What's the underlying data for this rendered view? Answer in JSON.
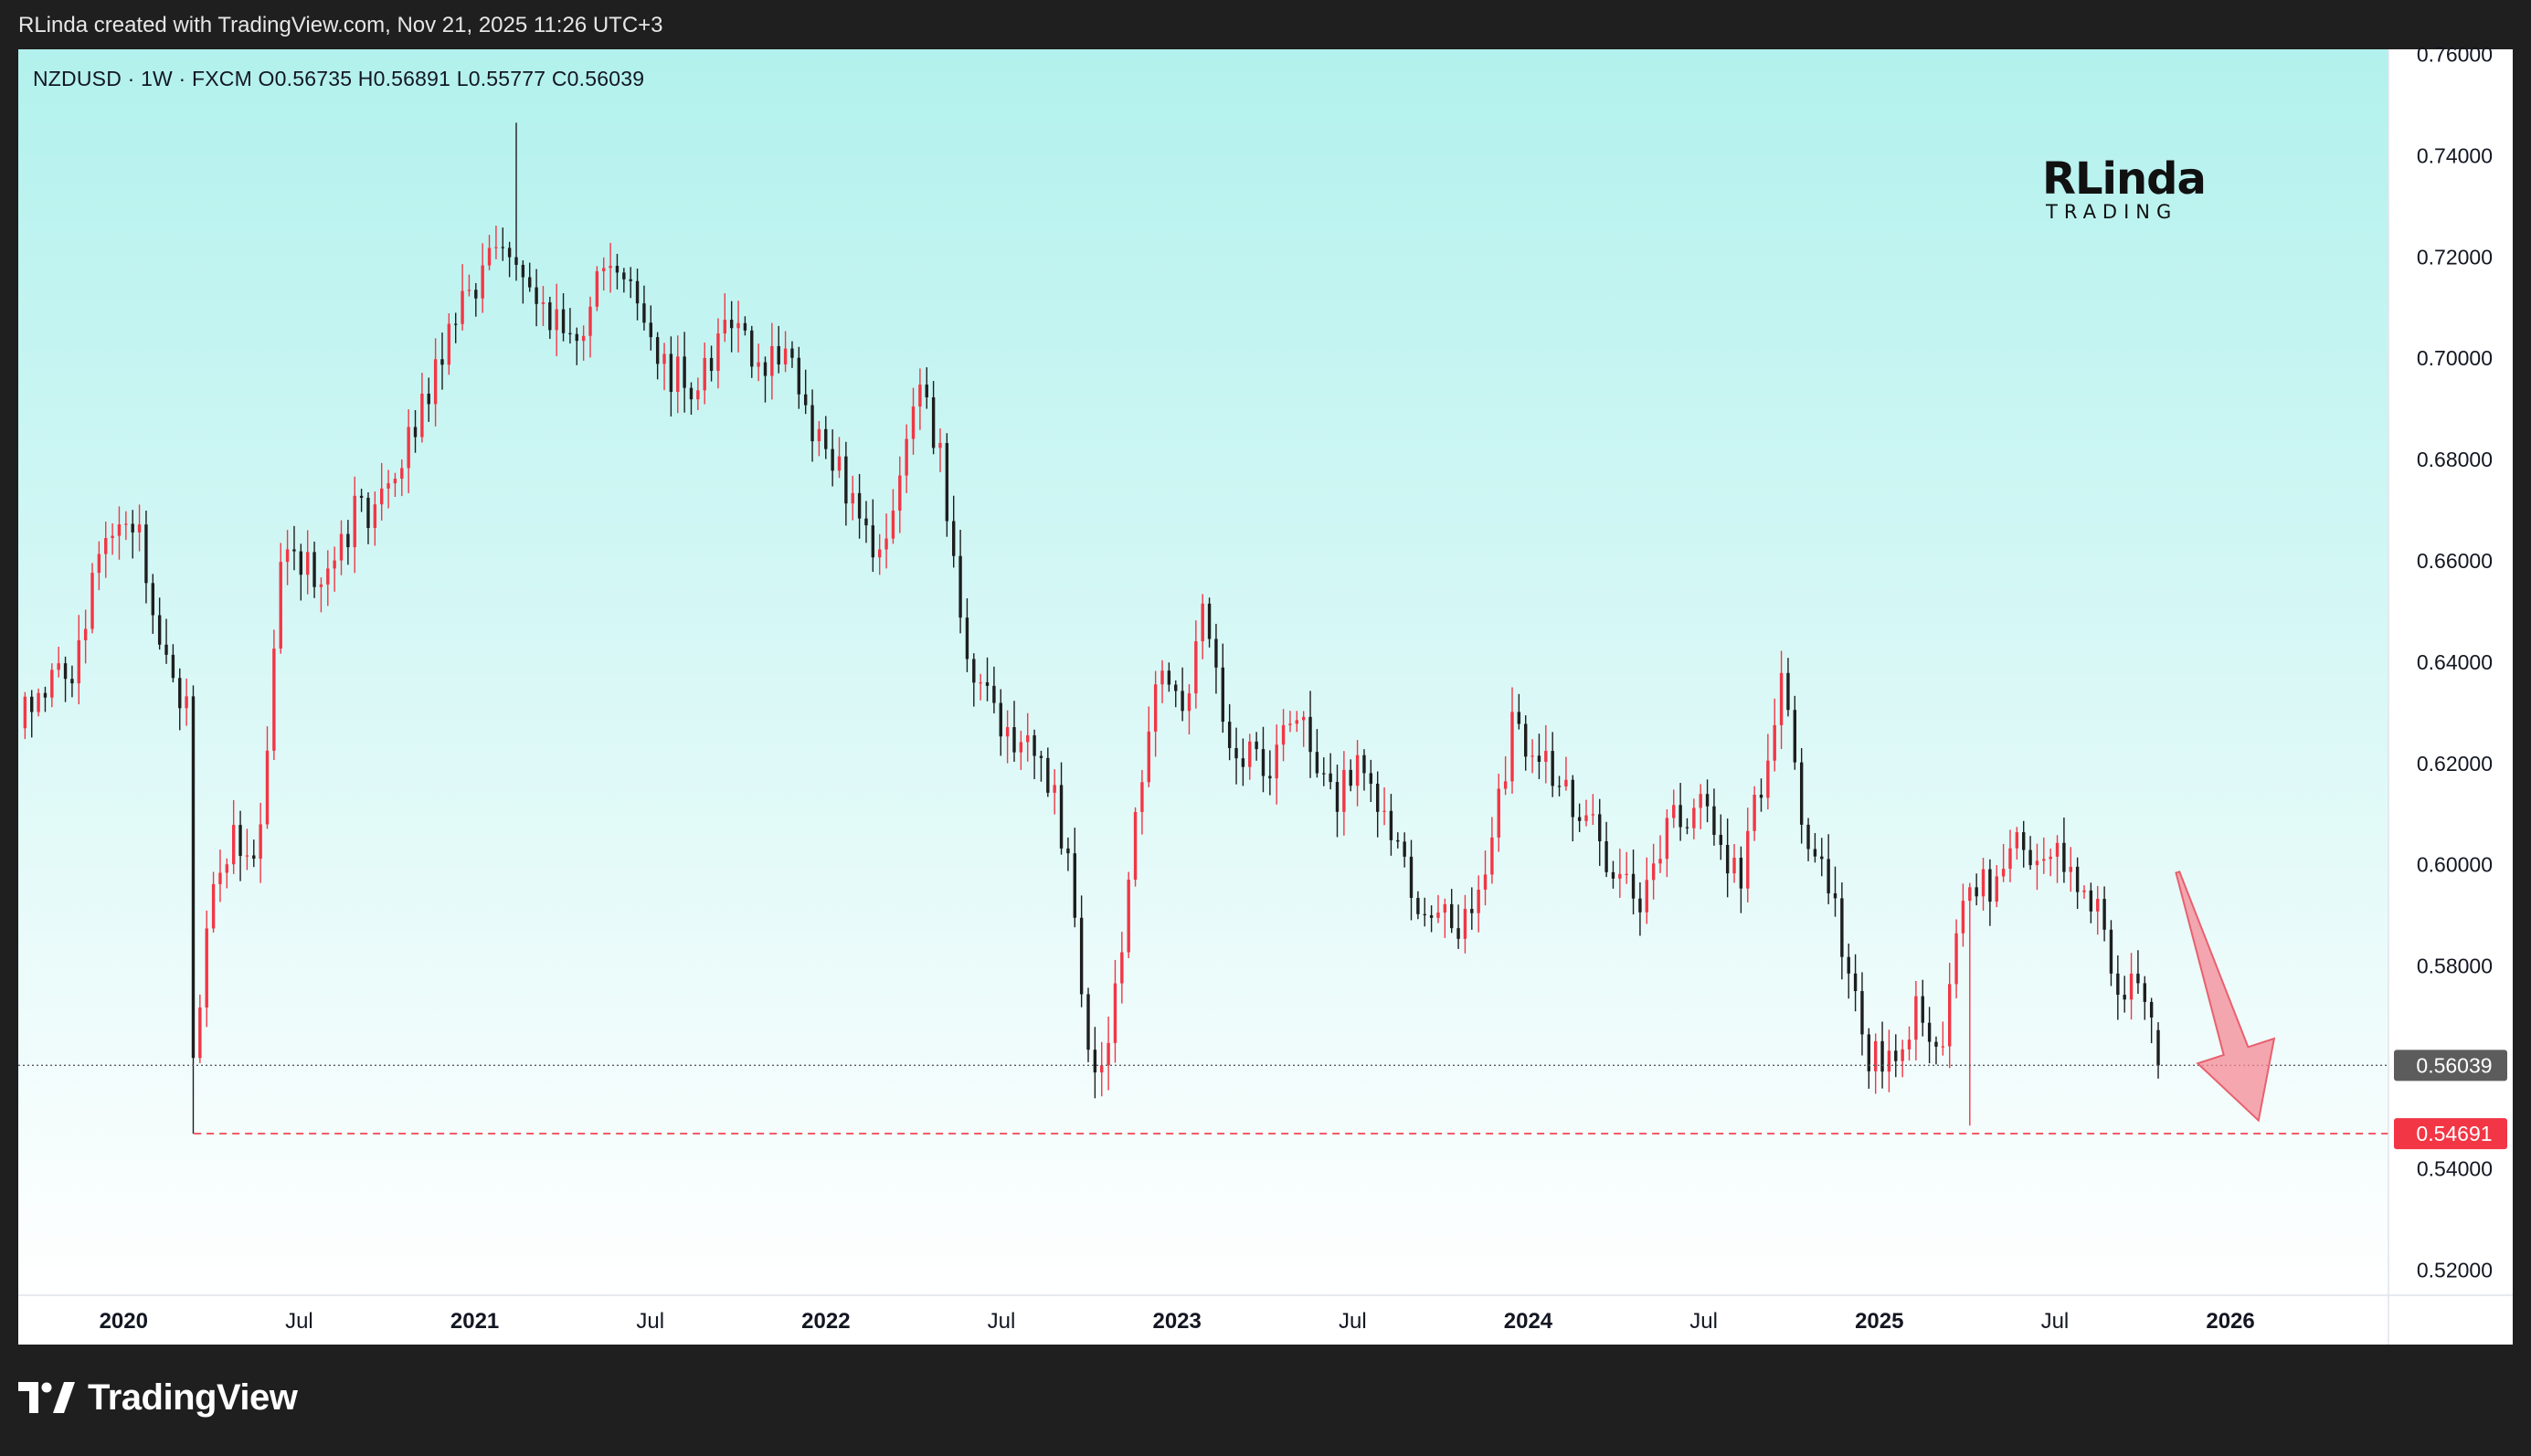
{
  "attribution": "RLinda created with TradingView.com, Nov 21, 2025 11:26 UTC+3",
  "symbol_line": "NZDUSD · 1W · FXCM   O0.56735   H0.56891   L0.55777   C0.56039",
  "logo": {
    "main": "RLinda",
    "sub": "TRADING"
  },
  "brand": {
    "name": "TradingView"
  },
  "colors": {
    "bg_top": "#b2f1ed",
    "bg_bottom": "#ffffff",
    "up": "#f23645",
    "down": "#1e1e1e",
    "current_label": "#5c5c5c",
    "support": "#f23645",
    "arrow": "#f58a95"
  },
  "chart_data": {
    "type": "candlestick",
    "symbol": "NZDUSD",
    "timeframe": "1W",
    "source": "FXCM",
    "ohlc_last": {
      "open": 0.56735,
      "high": 0.56891,
      "low": 0.55777,
      "close": 0.56039
    },
    "ylim": [
      0.515,
      0.761
    ],
    "yticks": [
      "0.76000",
      "0.74000",
      "0.72000",
      "0.70000",
      "0.68000",
      "0.66000",
      "0.64000",
      "0.62000",
      "0.60000",
      "0.58000",
      "0.56000",
      "0.54000",
      "0.52000"
    ],
    "xlim": [
      2019.7,
      2026.45
    ],
    "xticks": [
      {
        "label": "2020",
        "x": 2020.0,
        "bold": true
      },
      {
        "label": "Jul",
        "x": 2020.5,
        "bold": false
      },
      {
        "label": "2021",
        "x": 2021.0,
        "bold": true
      },
      {
        "label": "Jul",
        "x": 2021.5,
        "bold": false
      },
      {
        "label": "2022",
        "x": 2022.0,
        "bold": true
      },
      {
        "label": "Jul",
        "x": 2022.5,
        "bold": false
      },
      {
        "label": "2023",
        "x": 2023.0,
        "bold": true
      },
      {
        "label": "Jul",
        "x": 2023.5,
        "bold": false
      },
      {
        "label": "2024",
        "x": 2024.0,
        "bold": true
      },
      {
        "label": "Jul",
        "x": 2024.5,
        "bold": false
      },
      {
        "label": "2025",
        "x": 2025.0,
        "bold": true
      },
      {
        "label": "Jul",
        "x": 2025.5,
        "bold": false
      },
      {
        "label": "2026",
        "x": 2026.0,
        "bold": true
      }
    ],
    "current_price": {
      "value": 0.56039,
      "label": "0.56039"
    },
    "support_level": {
      "value": 0.54691,
      "label": "0.54691",
      "style": "dashed"
    },
    "arrow": {
      "from": {
        "x": 2025.85,
        "y": 0.5985
      },
      "to": {
        "x": 2026.08,
        "y": 0.5495
      },
      "direction": "down"
    },
    "anchors": [
      [
        2019.7,
        0.63
      ],
      [
        2019.85,
        0.638
      ],
      [
        2019.93,
        0.662
      ],
      [
        2020.0,
        0.67
      ],
      [
        2020.05,
        0.665
      ],
      [
        2020.12,
        0.64
      ],
      [
        2020.18,
        0.63
      ],
      [
        2020.2,
        0.56
      ],
      [
        2020.25,
        0.595
      ],
      [
        2020.3,
        0.605
      ],
      [
        2020.38,
        0.6
      ],
      [
        2020.45,
        0.66
      ],
      [
        2020.55,
        0.658
      ],
      [
        2020.65,
        0.668
      ],
      [
        2020.75,
        0.673
      ],
      [
        2020.85,
        0.69
      ],
      [
        2020.95,
        0.71
      ],
      [
        2021.05,
        0.718
      ],
      [
        2021.12,
        0.722
      ],
      [
        2021.2,
        0.712
      ],
      [
        2021.28,
        0.7
      ],
      [
        2021.35,
        0.718
      ],
      [
        2021.45,
        0.712
      ],
      [
        2021.55,
        0.698
      ],
      [
        2021.65,
        0.695
      ],
      [
        2021.72,
        0.712
      ],
      [
        2021.8,
        0.7
      ],
      [
        2021.9,
        0.7
      ],
      [
        2022.0,
        0.68
      ],
      [
        2022.1,
        0.672
      ],
      [
        2022.15,
        0.66
      ],
      [
        2022.22,
        0.678
      ],
      [
        2022.27,
        0.692
      ],
      [
        2022.33,
        0.68
      ],
      [
        2022.4,
        0.642
      ],
      [
        2022.48,
        0.63
      ],
      [
        2022.55,
        0.62
      ],
      [
        2022.6,
        0.625
      ],
      [
        2022.65,
        0.612
      ],
      [
        2022.7,
        0.595
      ],
      [
        2022.76,
        0.56
      ],
      [
        2022.82,
        0.57
      ],
      [
        2022.88,
        0.612
      ],
      [
        2022.95,
        0.636
      ],
      [
        2023.02,
        0.63
      ],
      [
        2023.08,
        0.65
      ],
      [
        2023.15,
        0.62
      ],
      [
        2023.25,
        0.62
      ],
      [
        2023.35,
        0.628
      ],
      [
        2023.45,
        0.61
      ],
      [
        2023.52,
        0.622
      ],
      [
        2023.6,
        0.61
      ],
      [
        2023.68,
        0.595
      ],
      [
        2023.78,
        0.588
      ],
      [
        2023.85,
        0.59
      ],
      [
        2023.9,
        0.61
      ],
      [
        2023.96,
        0.628
      ],
      [
        2024.05,
        0.62
      ],
      [
        2024.15,
        0.612
      ],
      [
        2024.25,
        0.598
      ],
      [
        2024.32,
        0.592
      ],
      [
        2024.4,
        0.608
      ],
      [
        2024.48,
        0.612
      ],
      [
        2024.55,
        0.605
      ],
      [
        2024.6,
        0.595
      ],
      [
        2024.65,
        0.612
      ],
      [
        2024.72,
        0.635
      ],
      [
        2024.78,
        0.61
      ],
      [
        2024.85,
        0.595
      ],
      [
        2024.9,
        0.585
      ],
      [
        2024.98,
        0.56
      ],
      [
        2025.05,
        0.565
      ],
      [
        2025.12,
        0.572
      ],
      [
        2025.18,
        0.565
      ],
      [
        2025.25,
        0.598
      ],
      [
        2025.32,
        0.596
      ],
      [
        2025.4,
        0.603
      ],
      [
        2025.48,
        0.602
      ],
      [
        2025.55,
        0.598
      ],
      [
        2025.62,
        0.59
      ],
      [
        2025.68,
        0.578
      ],
      [
        2025.73,
        0.575
      ],
      [
        2025.79,
        0.569
      ],
      [
        2025.81,
        0.5604
      ]
    ]
  }
}
